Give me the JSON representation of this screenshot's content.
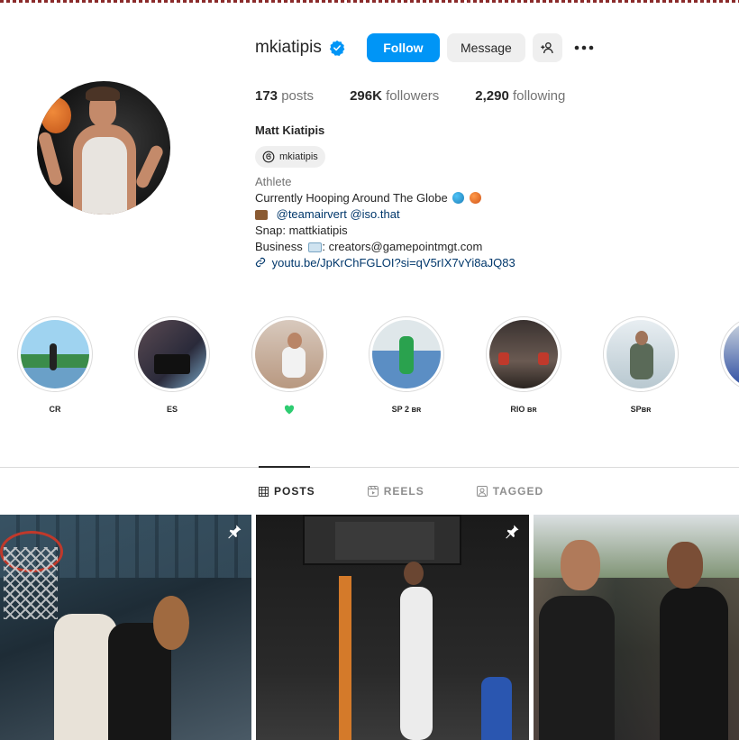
{
  "profile": {
    "username": "mkiatipis",
    "follow_label": "Follow",
    "message_label": "Message",
    "posts_count": "173",
    "posts_label": "posts",
    "followers_count": "296K",
    "followers_label": "followers",
    "following_count": "2,290",
    "following_label": "following",
    "full_name": "Matt Kiatipis",
    "threads_handle": "mkiatipis",
    "category": "Athlete",
    "bio_line1": "Currently Hooping Around The Globe",
    "bio_line2_a": "@teamairvert",
    "bio_line2_b": "@iso.that",
    "bio_line3": "Snap: mattkiatipis",
    "bio_line4_prefix": "Business",
    "bio_line4_suffix": ": creators@gamepointmgt.com",
    "link": "youtu.be/JpKrChFGLOI?si=qV5rIX7vYi8aJQ83"
  },
  "highlights": [
    {
      "label": "CR"
    },
    {
      "label": "ES"
    },
    {
      "label": ""
    },
    {
      "label": "SP 2 ʙʀ"
    },
    {
      "label": "RIO ʙʀ"
    },
    {
      "label": "SPʙʀ"
    }
  ],
  "tabs": {
    "posts": "POSTS",
    "reels": "REELS",
    "tagged": "TAGGED"
  },
  "colors": {
    "accent": "#0095f6",
    "link": "#00376b",
    "secondary_text": "#737373"
  }
}
